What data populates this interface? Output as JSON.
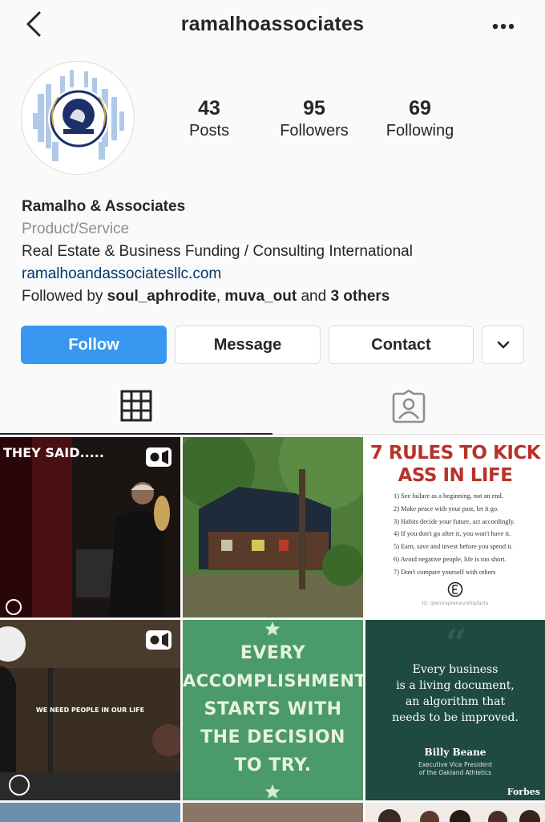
{
  "header": {
    "username": "ramalhoassociates"
  },
  "stats": [
    {
      "count": "43",
      "label": "Posts"
    },
    {
      "count": "95",
      "label": "Followers"
    },
    {
      "count": "69",
      "label": "Following"
    }
  ],
  "bio": {
    "name": "Ramalho & Associates",
    "category": "Product/Service",
    "description": "Real Estate & Business Funding / Consulting International",
    "link": "ramalhoandassociatesllc.com",
    "followed_prefix": "Followed by ",
    "followed_user1": "soul_aphrodite",
    "followed_sep": ", ",
    "followed_user2": "muva_out",
    "followed_and": " and ",
    "followed_others": "3 others"
  },
  "buttons": {
    "follow": "Follow",
    "message": "Message",
    "contact": "Contact"
  },
  "posts": {
    "p1_caption": "THEY SAID.....",
    "p3_title_line1": "7 RULES TO KICK",
    "p3_title_line2": "ASS IN LIFE",
    "p3_rules": [
      "1) See failure as a beginning, not an end.",
      "2) Make peace with your past, let it go.",
      "3) Habits decide your future, act accordingly.",
      "4) If you don't go after it, you won't have it.",
      "5) Earn, save and invest before you spend it.",
      "6) Avoid negative people, life is too short.",
      "7) Don't compare yourself with others"
    ],
    "p3_handle": "IG: @entrepreneurshipfacts",
    "p4_caption": "WE NEED PEOPLE IN OUR LIFE",
    "p5_lines": [
      "EVERY",
      "ACCOMPLISHMENT",
      "STARTS WITH",
      "THE DECISION",
      "TO TRY."
    ],
    "p6_quote_lines": [
      "Every business",
      "is a living document,",
      "an algorithm that",
      "needs to be improved."
    ],
    "p6_author": "Billy Beane",
    "p6_role_line1": "Executive Vice President",
    "p6_role_line2": "of the Oakland Athletics",
    "p6_brand": "Forbes"
  },
  "colors": {
    "follow_blue": "#3897f0",
    "link": "#00376b",
    "green_tile": "#4a9a6a",
    "dark_green_tile": "#1f4a3f",
    "rules_red": "#b7322a"
  },
  "icons": [
    "back-chevron-icon",
    "more-dots-icon",
    "grid-icon",
    "tagged-icon",
    "chevron-down-icon",
    "video-icon"
  ]
}
